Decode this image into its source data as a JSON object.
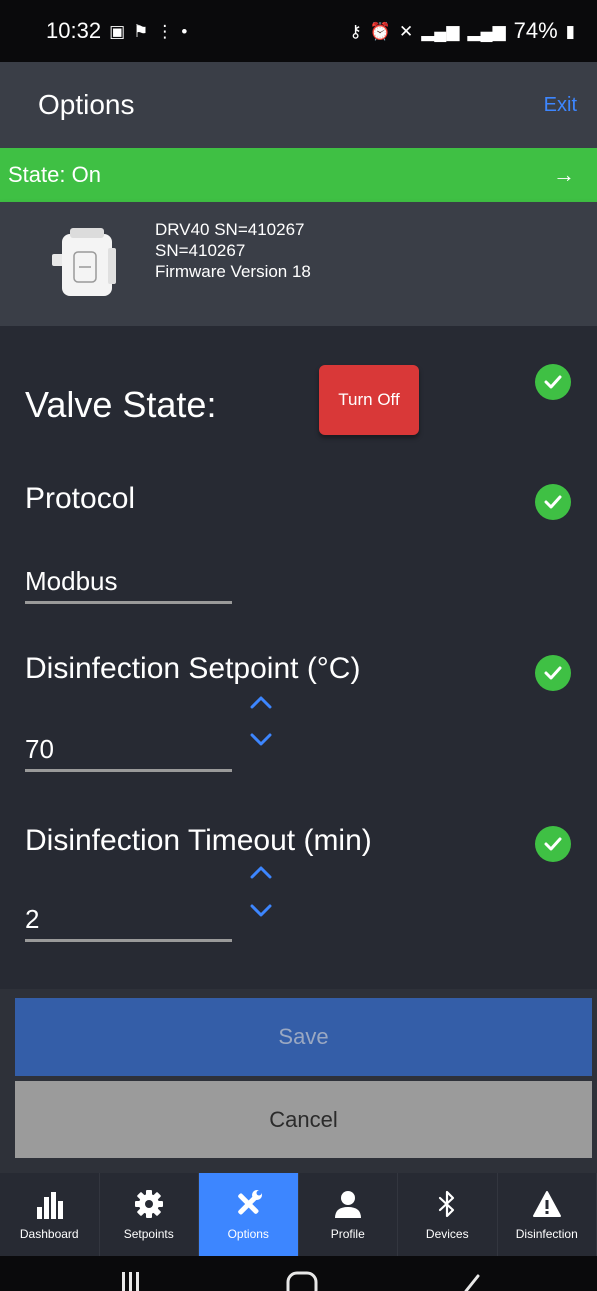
{
  "status_bar": {
    "time": "10:32",
    "battery": "74%"
  },
  "header": {
    "title": "Options",
    "exit_label": "Exit"
  },
  "state_banner": {
    "text": "State: On"
  },
  "device": {
    "line1": "DRV40 SN=410267",
    "line2": "SN=410267",
    "line3": "Firmware Version 18"
  },
  "valve": {
    "label": "Valve State:",
    "button_label": "Turn Off"
  },
  "protocol": {
    "label": "Protocol",
    "value": "Modbus"
  },
  "setpoint": {
    "label": "Disinfection Setpoint (°C)",
    "value": "70"
  },
  "timeout": {
    "label": "Disinfection Timeout (min)",
    "value": "2"
  },
  "actions": {
    "save_label": "Save",
    "cancel_label": "Cancel"
  },
  "nav": {
    "items": [
      {
        "label": "Dashboard",
        "icon": "bar-chart-icon"
      },
      {
        "label": "Setpoints",
        "icon": "gear-icon"
      },
      {
        "label": "Options",
        "icon": "tools-icon"
      },
      {
        "label": "Profile",
        "icon": "person-icon"
      },
      {
        "label": "Devices",
        "icon": "bluetooth-icon"
      },
      {
        "label": "Disinfection",
        "icon": "warning-icon"
      }
    ]
  },
  "colors": {
    "accent": "#3d86ff",
    "state_on": "#3fc044",
    "turn_off": "#d93838",
    "save": "#345ea8",
    "cancel": "#9b9b9b"
  }
}
